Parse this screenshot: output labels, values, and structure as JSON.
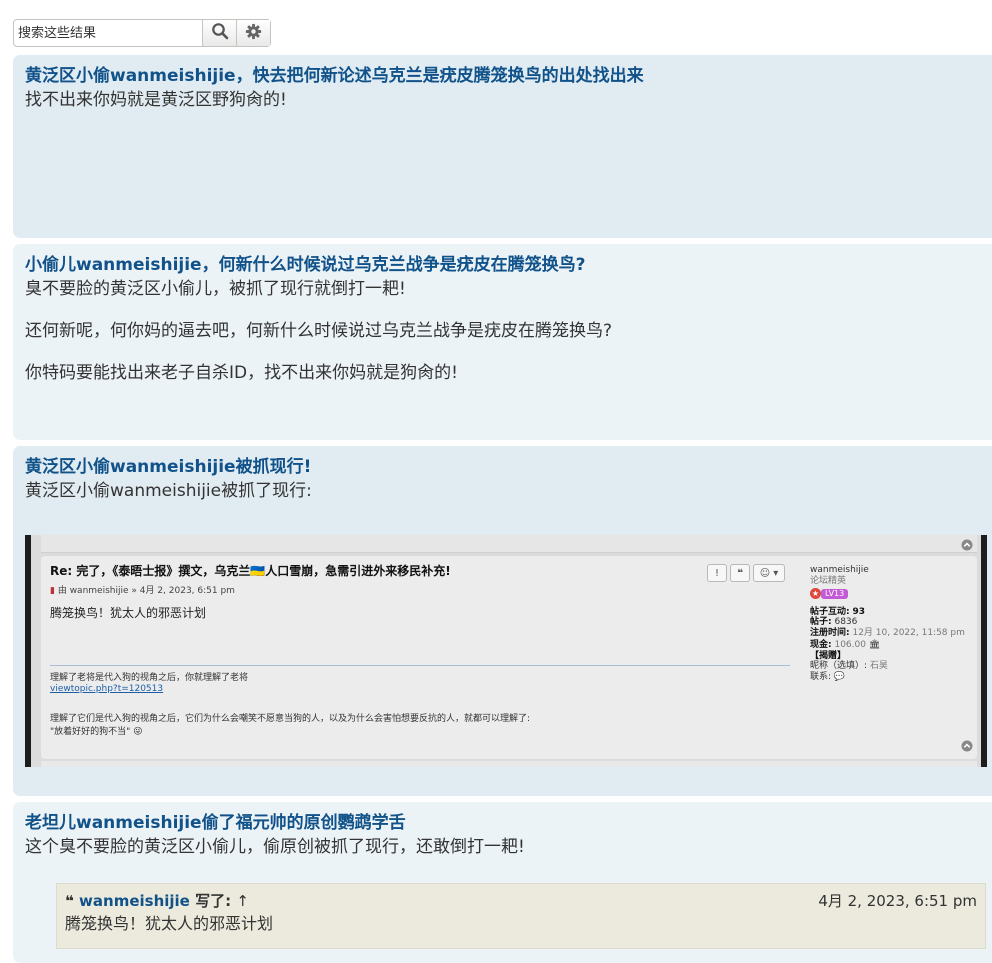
{
  "search": {
    "placeholder": "搜索这些结果",
    "search_icon": "search-icon",
    "settings_icon": "gear-icon"
  },
  "posts": [
    {
      "title": "黄泛区小偷wanmeishijie，快去把何新论述乌克兰是疣皮腾笼换鸟的出处找出来",
      "lines": [
        "找不出来你妈就是黄泛区野狗肏的!"
      ]
    },
    {
      "title": "小偷儿wanmeishijie，何新什么时候说过乌克兰战争是疣皮在腾笼换鸟?",
      "lines": [
        "臭不要脸的黄泛区小偷儿，被抓了现行就倒打一耙!",
        "还何新呢，何你妈的逼去吧，何新什么时候说过乌克兰战争是疣皮在腾笼换鸟?",
        "你特码要能找出来老子自杀ID，找不出来你妈就是狗肏的!"
      ]
    },
    {
      "title": "黄泛区小偷wanmeishijie被抓现行!",
      "lines": [
        "黄泛区小偷wanmeishijie被抓了现行:"
      ]
    },
    {
      "title": "老坦儿wanmeishijie偷了福元帅的原创鹦鹉学舌",
      "lines": [
        "这个臭不要脸的黄泛区小偷儿，偷原创被抓了现行，还敢倒打一耙!"
      ]
    }
  ],
  "screenshot": {
    "title": "Re: 完了，《泰晤士报》撰文，乌克兰🇺🇦人口雪崩，急需引进外来移民补充!",
    "meta": "由 wanmeishijie » 4月 2, 2023, 6:51 pm",
    "body": "腾笼换鸟！犹太人的邪恶计划",
    "sig1": "理解了老将是代入狗的视角之后，你就理解了老将",
    "sig_link": "viewtopic.php?t=120513",
    "sig2": "理解了它们是代入狗的视角之后，它们为什么会嘲笑不愿意当狗的人，以及为什么会害怕想要反抗的人，就都可以理解了:",
    "sig3": "\"放着好好的狗不当\" 😜",
    "author": "wanmeishijie",
    "rank": "论坛精英",
    "level": "LV13",
    "stat1_label": "帖子互动:",
    "stat1_value": "93",
    "stat2_label": "帖子:",
    "stat2_value": "6836",
    "stat3_label": "注册时间:",
    "stat3_value": "12月 10, 2022, 11:58 pm",
    "stat4_label": "现金:",
    "stat4_value": "106.00",
    "stat5_label": "【揭赠】",
    "stat6_label": "昵称（选填）:",
    "stat6_value": "石昊",
    "stat7_label": "联系:"
  },
  "quote": {
    "author": "wanmeishijie",
    "wrote": "写了:",
    "arrow": "↑",
    "date": "4月 2, 2023, 6:51 pm",
    "text": "腾笼换鸟！犹太人的邪恶计划"
  }
}
